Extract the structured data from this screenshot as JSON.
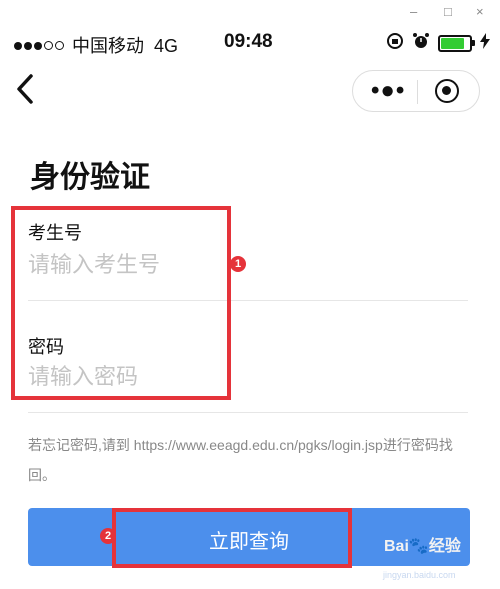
{
  "window": {
    "minimize": "–",
    "maximize": "□",
    "close": "×"
  },
  "status_bar": {
    "carrier": "中国移动",
    "network": "4G",
    "time": "09:48",
    "icons": [
      "lock-rotation-icon",
      "alarm-icon",
      "battery-icon",
      "charging-icon"
    ],
    "battery_color": "#33cc33"
  },
  "nav": {
    "back_icon": "chevron-left-icon",
    "more_icon": "more-dots-icon",
    "close_icon": "target-icon"
  },
  "page": {
    "title": "身份验证"
  },
  "form": {
    "exam_id": {
      "label": "考生号",
      "placeholder": "请输入考生号"
    },
    "password": {
      "label": "密码",
      "placeholder": "请输入密码"
    }
  },
  "hint": "若忘记密码,请到 https://www.eeagd.edu.cn/pgks/login.jsp进行密码找回。",
  "submit": {
    "label": "立即查询",
    "color": "#4c8fec"
  },
  "annotations": {
    "badge1": "1",
    "badge2": "2",
    "color": "#e5333a"
  },
  "watermark": {
    "text": "Bai",
    "suffix": "经验",
    "sub": "jingyan.baidu.com"
  }
}
